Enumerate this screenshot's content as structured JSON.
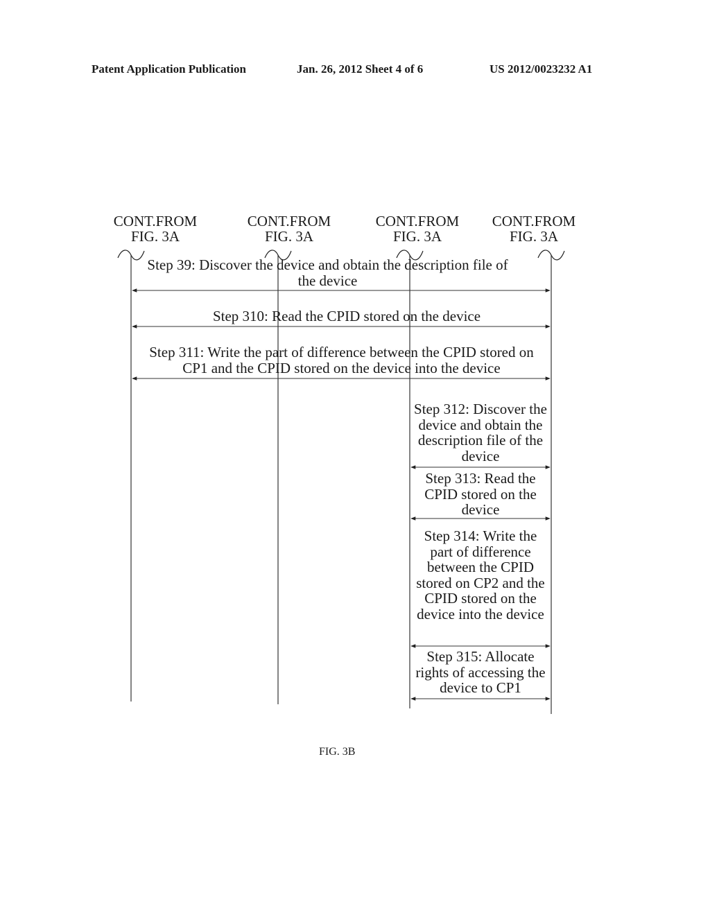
{
  "header": {
    "left": "Patent Application Publication",
    "center": "Jan. 26, 2012  Sheet 4 of 6",
    "right": "US 2012/0023232 A1"
  },
  "lifeline_labels": [
    {
      "line1": "CONT.FROM",
      "line2": "FIG. 3A"
    },
    {
      "line1": "CONT.FROM",
      "line2": "FIG. 3A"
    },
    {
      "line1": "CONT.FROM",
      "line2": "FIG. 3A"
    },
    {
      "line1": "CONT.FROM",
      "line2": "FIG. 3A"
    }
  ],
  "steps": [
    {
      "id": "39",
      "text": "Step 39: Discover the device and obtain the description file of the device",
      "from": 1,
      "to": 4,
      "arrow": "both"
    },
    {
      "id": "310",
      "text": "Step 310: Read the CPID stored on the device",
      "from": 1,
      "to": 4,
      "arrow": "both"
    },
    {
      "id": "311",
      "text": "Step 311: Write the part of difference between the CPID stored on CP1 and the CPID stored on the device into the device",
      "from": 1,
      "to": 4,
      "arrow": "both"
    },
    {
      "id": "312",
      "text": "Step 312: Discover the device and obtain the description file of the device",
      "from": 3,
      "to": 4,
      "arrow": "both"
    },
    {
      "id": "313",
      "text": "Step 313: Read the CPID stored on the device",
      "from": 3,
      "to": 4,
      "arrow": "both"
    },
    {
      "id": "314",
      "text": "Step 314: Write the part of difference between the CPID stored on CP2 and the CPID stored on the device into the device",
      "from": 3,
      "to": 4,
      "arrow": "both"
    },
    {
      "id": "315",
      "text": "Step 315: Allocate rights of accessing the device to CP1",
      "from": 3,
      "to": 4,
      "arrow": "both"
    }
  ],
  "caption": "FIG. 3B"
}
